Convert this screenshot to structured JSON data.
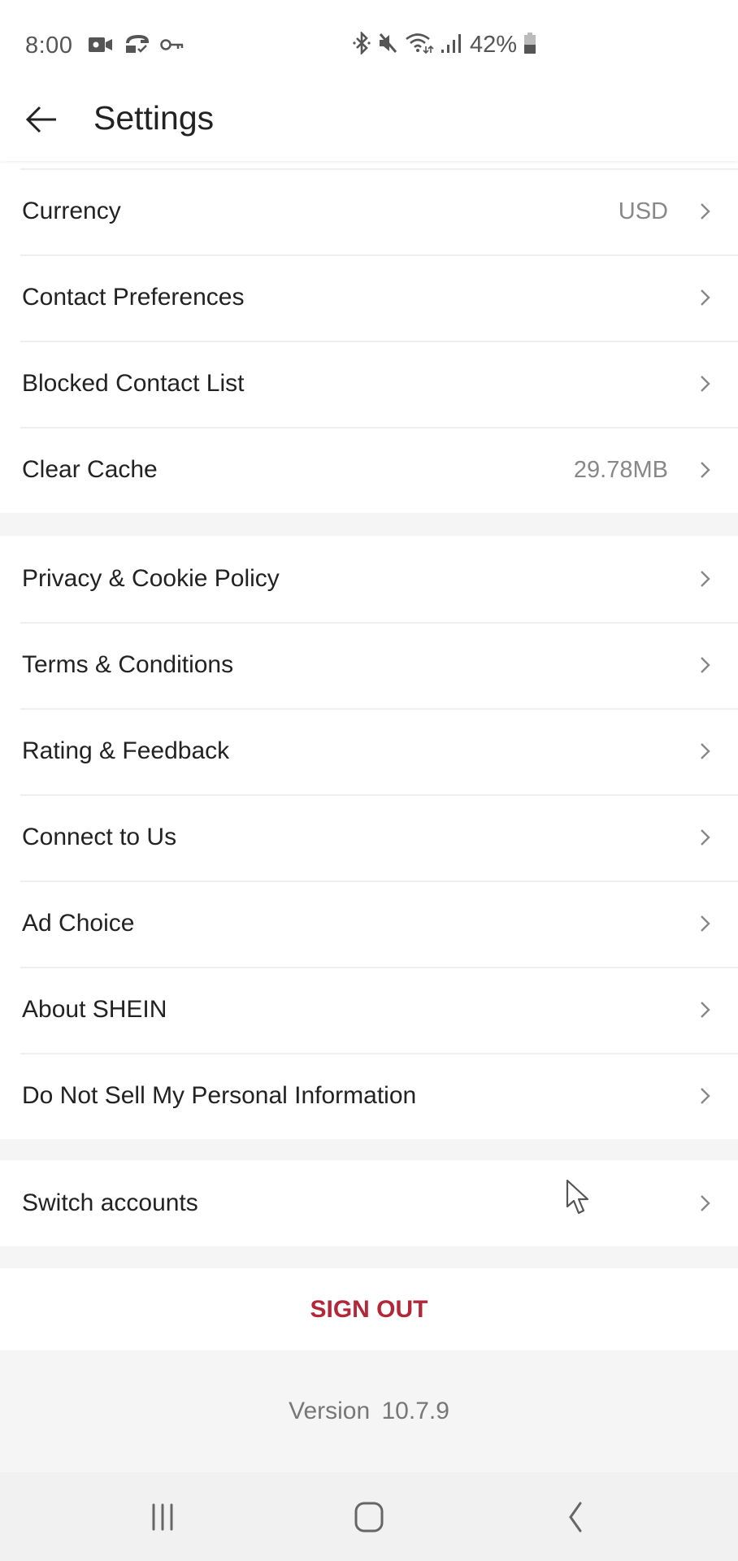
{
  "status_bar": {
    "time": "8:00",
    "left_icons": [
      "video-camera-icon",
      "sync-check-icon",
      "key-icon"
    ],
    "right_icons": [
      "bluetooth-icon",
      "mute-icon",
      "wifi-icon",
      "signal-icon"
    ],
    "battery_percent": "42%"
  },
  "header": {
    "back_icon": "arrow-left-icon",
    "title": "Settings"
  },
  "sections": [
    {
      "items": [
        {
          "label": "Currency",
          "value": "USD"
        },
        {
          "label": "Contact Preferences",
          "value": ""
        },
        {
          "label": "Blocked Contact List",
          "value": ""
        },
        {
          "label": "Clear Cache",
          "value": "29.78MB"
        }
      ]
    },
    {
      "items": [
        {
          "label": "Privacy & Cookie Policy",
          "value": ""
        },
        {
          "label": "Terms & Conditions",
          "value": ""
        },
        {
          "label": "Rating & Feedback",
          "value": ""
        },
        {
          "label": "Connect to Us",
          "value": ""
        },
        {
          "label": "Ad Choice",
          "value": ""
        },
        {
          "label": "About SHEIN",
          "value": ""
        },
        {
          "label": "Do Not Sell My Personal Information",
          "value": ""
        }
      ]
    },
    {
      "items": [
        {
          "label": "Switch accounts",
          "value": ""
        }
      ]
    }
  ],
  "sign_out": {
    "label": "SIGN OUT",
    "color": "#b32838"
  },
  "version": {
    "text": "Version  10.7.9"
  },
  "nav_bar": {
    "buttons": [
      "recent-apps-icon",
      "home-icon",
      "back-icon"
    ]
  }
}
